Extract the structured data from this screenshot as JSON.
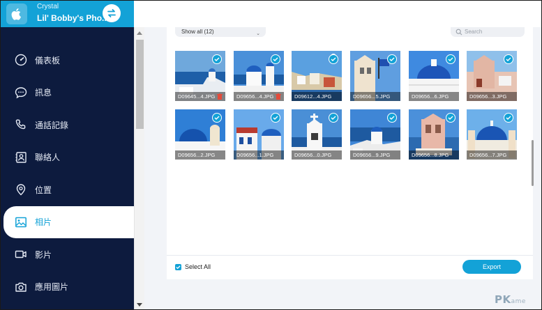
{
  "device": {
    "owner": "Crystal",
    "name": "Lil' Bobby's Pho..."
  },
  "sidebar": {
    "items": [
      {
        "label": "儀表板",
        "icon": "gauge-icon",
        "active": false
      },
      {
        "label": "訊息",
        "icon": "chat-bubble-icon",
        "active": false
      },
      {
        "label": "通話記錄",
        "icon": "phone-icon",
        "active": false
      },
      {
        "label": "聯絡人",
        "icon": "contact-card-icon",
        "active": false
      },
      {
        "label": "位置",
        "icon": "location-pin-icon",
        "active": false
      },
      {
        "label": "相片",
        "icon": "image-icon",
        "active": true
      },
      {
        "label": "影片",
        "icon": "video-camera-icon",
        "active": false
      },
      {
        "label": "應用圖片",
        "icon": "camera-icon",
        "active": false
      }
    ]
  },
  "filter": {
    "selected": "Show all (12)",
    "search_placeholder": "Search"
  },
  "photos": [
    {
      "name": "D09645...4.JPG",
      "checked": true,
      "trash": true
    },
    {
      "name": "D09656...4.JPG",
      "checked": true,
      "trash": true
    },
    {
      "name": "D09612...4.JPG",
      "checked": true,
      "trash": false
    },
    {
      "name": "D09656...5.JPG",
      "checked": true,
      "trash": false
    },
    {
      "name": "D09656...6.JPG",
      "checked": true,
      "trash": false
    },
    {
      "name": "D09656...3.JPG",
      "checked": true,
      "trash": false
    },
    {
      "name": "D09656...2.JPG",
      "checked": true,
      "trash": false
    },
    {
      "name": "D09656...1.JPG",
      "checked": true,
      "trash": false
    },
    {
      "name": "D09656...0.JPG",
      "checked": true,
      "trash": false
    },
    {
      "name": "D09656...9.JPG",
      "checked": true,
      "trash": false
    },
    {
      "name": "D09656...8.JPG",
      "checked": true,
      "trash": false
    },
    {
      "name": "D09656...7.JPG",
      "checked": true,
      "trash": false
    }
  ],
  "footer": {
    "select_all_label": "Select All",
    "select_all_checked": true,
    "export_label": "Export"
  },
  "watermark": {
    "text": "PK",
    "suffix": "ame"
  },
  "colors": {
    "accent": "#13a2d7",
    "sidebar_bg": "#0d1b3e",
    "delete_red": "#e34b3b"
  }
}
